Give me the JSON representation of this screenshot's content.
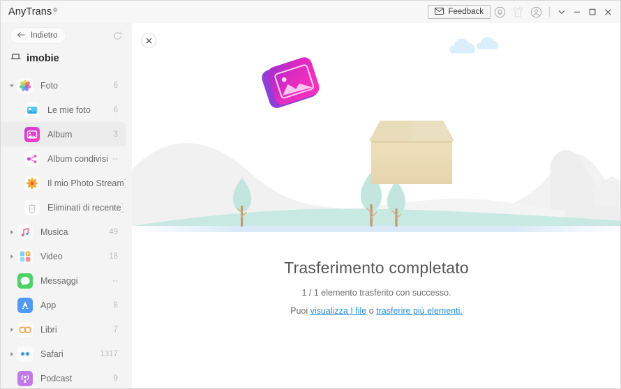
{
  "titlebar": {
    "brand": "AnyTrans",
    "registered_mark": "®",
    "feedback_label": "Feedback",
    "icons": {
      "feedback": "envelope-icon",
      "notifications": "bell-icon",
      "gift": "tshirt-icon",
      "account": "user-circle-icon",
      "more": "chevron-down-icon",
      "minimize": "minimize-icon",
      "maximize": "maximize-icon",
      "close": "close-icon"
    }
  },
  "sidebar": {
    "back_label": "Indietro",
    "refresh_icon": "refresh-icon",
    "device_name": "imobie",
    "device_icon": "device-icon",
    "items": [
      {
        "label": "Foto",
        "count": "6",
        "level": 1,
        "expandable": true,
        "expanded": true,
        "selected": false,
        "icon": "photos-icon"
      },
      {
        "label": "Le mie foto",
        "count": "6",
        "level": 2,
        "expandable": false,
        "expanded": false,
        "selected": false,
        "icon": "my-photos-icon"
      },
      {
        "label": "Album",
        "count": "3",
        "level": 2,
        "expandable": false,
        "expanded": false,
        "selected": true,
        "icon": "album-icon"
      },
      {
        "label": "Album condivisi",
        "count": "--",
        "level": 2,
        "expandable": false,
        "expanded": false,
        "selected": false,
        "icon": "shared-album-icon"
      },
      {
        "label": "Il mio Photo Stream",
        "count": "--",
        "level": 2,
        "expandable": false,
        "expanded": false,
        "selected": false,
        "icon": "photo-stream-icon"
      },
      {
        "label": "Eliminati di recente",
        "count": "--",
        "level": 2,
        "expandable": false,
        "expanded": false,
        "selected": false,
        "icon": "trash-icon"
      },
      {
        "label": "Musica",
        "count": "49",
        "level": 1,
        "expandable": true,
        "expanded": false,
        "selected": false,
        "icon": "music-icon"
      },
      {
        "label": "Video",
        "count": "18",
        "level": 1,
        "expandable": true,
        "expanded": false,
        "selected": false,
        "icon": "video-icon"
      },
      {
        "label": "Messaggi",
        "count": "--",
        "level": 1,
        "expandable": false,
        "expanded": false,
        "selected": false,
        "icon": "messages-icon"
      },
      {
        "label": "App",
        "count": "8",
        "level": 1,
        "expandable": false,
        "expanded": false,
        "selected": false,
        "icon": "appstore-icon"
      },
      {
        "label": "Libri",
        "count": "7",
        "level": 1,
        "expandable": true,
        "expanded": false,
        "selected": false,
        "icon": "books-icon"
      },
      {
        "label": "Safari",
        "count": "1317",
        "level": 1,
        "expandable": true,
        "expanded": false,
        "selected": false,
        "icon": "safari-icon"
      },
      {
        "label": "Podcast",
        "count": "9",
        "level": 1,
        "expandable": false,
        "expanded": false,
        "selected": false,
        "icon": "podcast-icon"
      }
    ]
  },
  "main": {
    "close_icon": "close-icon",
    "headline": "Trasferimento completato",
    "subline": "1 / 1 elemento trasferito con successo.",
    "link_prefix": "Puoi ",
    "link_view": "visualizza I file",
    "link_middle": " o ",
    "link_more": "trasferire più elementi.",
    "illustration": "delivery-box-landscape-illustration"
  },
  "colors": {
    "link": "#2693d6",
    "sidebar_bg": "#f4f4f4",
    "titlebar_bg": "#f7f7f7",
    "selected_row": "#ececec",
    "box": "#e3d3ab",
    "album_pink": "#ef2ec0",
    "tree_green": "#bfe5dd",
    "ground_blue": "#dbeaf8"
  }
}
